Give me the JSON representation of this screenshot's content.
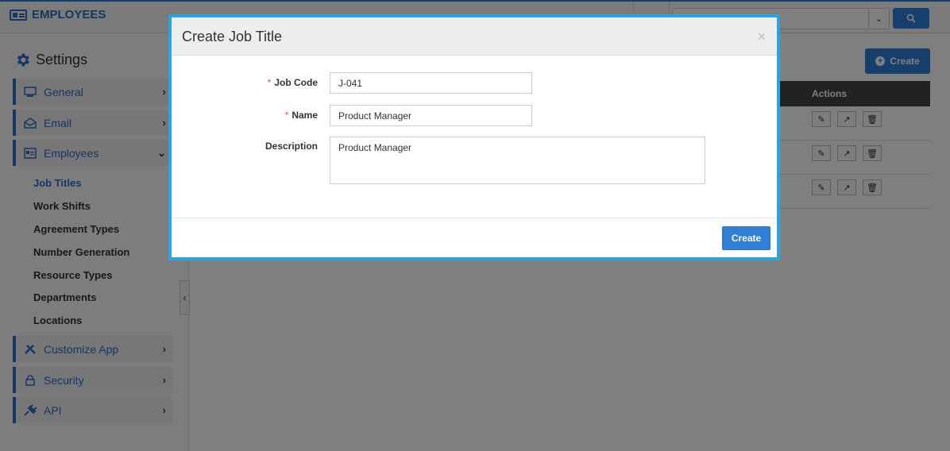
{
  "app": {
    "title": "EMPLOYEES",
    "brand_color": "#2a6fc9",
    "accent_color": "#2f7fd6"
  },
  "header": {
    "search_placeholder": "",
    "search_button_icon": "search-icon",
    "dropdown_icon": "chevron-down-icon"
  },
  "sidebar": {
    "heading": "Settings",
    "items": [
      {
        "label": "General",
        "icon": "monitor-icon",
        "expanded": false
      },
      {
        "label": "Email",
        "icon": "envelope-icon",
        "expanded": false
      },
      {
        "label": "Employees",
        "icon": "id-card-icon",
        "expanded": true
      },
      {
        "label": "Customize App",
        "icon": "tools-icon",
        "expanded": false
      },
      {
        "label": "Security",
        "icon": "lock-icon",
        "expanded": false
      },
      {
        "label": "API",
        "icon": "plug-icon",
        "expanded": false
      }
    ],
    "sub_items": [
      {
        "label": "Job Titles",
        "active": true
      },
      {
        "label": "Work Shifts",
        "active": false
      },
      {
        "label": "Agreement Types",
        "active": false
      },
      {
        "label": "Number Generation",
        "active": false
      },
      {
        "label": "Resource Types",
        "active": false
      },
      {
        "label": "Departments",
        "active": false
      },
      {
        "label": "Locations",
        "active": false
      }
    ]
  },
  "main": {
    "create_label": "Create",
    "table": {
      "actions_header": "Actions",
      "row_count": 3
    }
  },
  "modal": {
    "title": "Create Job Title",
    "close_symbol": "×",
    "fields": {
      "job_code": {
        "label": "Job Code",
        "value": "J-041",
        "required": true
      },
      "name": {
        "label": "Name",
        "value": "Product Manager",
        "required": true
      },
      "description": {
        "label": "Description",
        "value": "Product Manager",
        "required": false
      }
    },
    "required_marker": "*",
    "submit_label": "Create"
  }
}
